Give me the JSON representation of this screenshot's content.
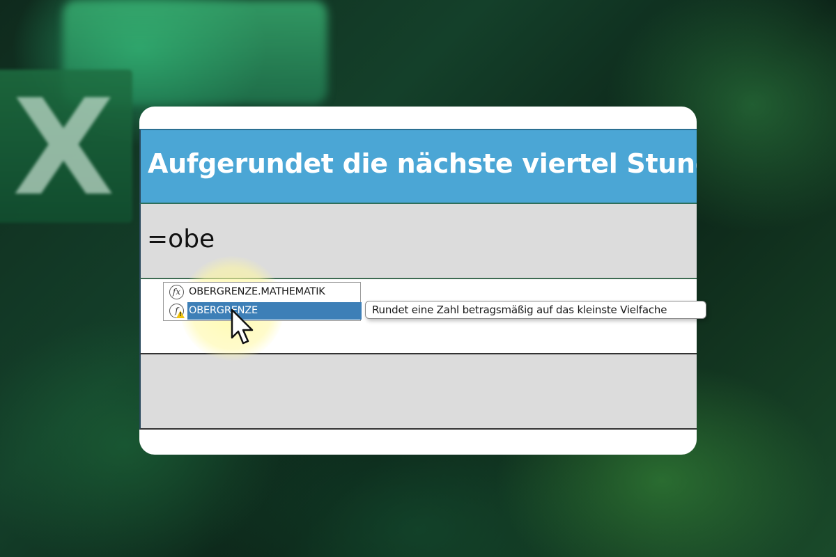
{
  "sheet": {
    "title": "Aufgerundet die nächste viertel Stunde",
    "formula_input": "=obe"
  },
  "autocomplete": {
    "items": [
      {
        "label": "OBERGRENZE.MATHEMATIK",
        "icon": "function-icon",
        "selected": false
      },
      {
        "label": "OBERGRENZE",
        "icon": "function-warning-icon",
        "selected": true
      }
    ],
    "tooltip": "Rundet eine Zahl betragsmäßig auf das kleinste Vielfache"
  },
  "colors": {
    "title_bg": "#4ba6d5",
    "selection": "#3d7fb7",
    "row_gray": "#dcdcdc"
  }
}
